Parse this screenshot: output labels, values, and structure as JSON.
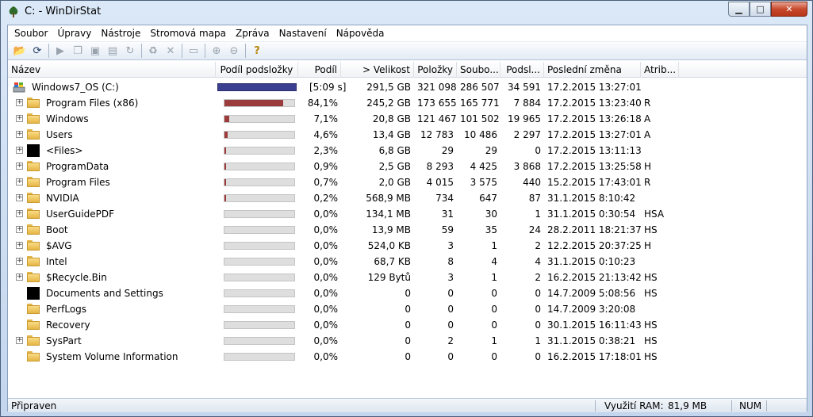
{
  "window": {
    "title": "C: - WinDirStat",
    "controls": {
      "minimize": "▁",
      "maximize": "□",
      "close": "✕"
    }
  },
  "menu": [
    "Soubor",
    "Úpravy",
    "Nástroje",
    "Stromová mapa",
    "Zpráva",
    "Nastavení",
    "Nápověda"
  ],
  "toolbar": {
    "icons": [
      "open-folder-icon",
      "refresh-icon",
      "play-icon",
      "copy-icon",
      "explorer-icon",
      "cmd-icon",
      "refresh-selected-icon",
      "recycle-icon",
      "delete-icon",
      "new-folder-icon",
      "zoom-in-icon",
      "zoom-out-icon",
      "help-icon"
    ]
  },
  "columns": [
    "Název",
    "Podíl podsložky",
    "Podíl",
    "> Velikost",
    "Položky",
    "Soubo...",
    "Podsl...",
    "Poslední změna",
    "Atrib..."
  ],
  "root": {
    "name": "Windows7_OS (C:)",
    "time": "[5:09 s]",
    "size": "291,5 GB",
    "items": "321 098",
    "files": "286 507",
    "subdirs": "34 591",
    "modified": "17.2.2015  13:27:01",
    "attrib": ""
  },
  "rows": [
    {
      "name": "Program Files (x86)",
      "expander": true,
      "icon": "folder",
      "fraction": 0.841,
      "pct": "84,1%",
      "size": "245,2 GB",
      "items": "173 655",
      "files": "165 771",
      "subdirs": "7 884",
      "modified": "17.2.2015  13:23:40",
      "attrib": "R"
    },
    {
      "name": "Windows",
      "expander": true,
      "icon": "folder",
      "fraction": 0.071,
      "pct": "7,1%",
      "size": "20,8 GB",
      "items": "121 467",
      "files": "101 502",
      "subdirs": "19 965",
      "modified": "17.2.2015  13:26:18",
      "attrib": "A"
    },
    {
      "name": "Users",
      "expander": true,
      "icon": "folder",
      "fraction": 0.046,
      "pct": "4,6%",
      "size": "13,4 GB",
      "items": "12 783",
      "files": "10 486",
      "subdirs": "2 297",
      "modified": "17.2.2015  13:27:01",
      "attrib": "A"
    },
    {
      "name": "<Files>",
      "expander": true,
      "icon": "black",
      "fraction": 0.023,
      "pct": "2,3%",
      "size": "6,8 GB",
      "items": "29",
      "files": "29",
      "subdirs": "0",
      "modified": "17.2.2015  13:11:13",
      "attrib": ""
    },
    {
      "name": "ProgramData",
      "expander": true,
      "icon": "folder",
      "fraction": 0.009,
      "pct": "0,9%",
      "size": "2,5 GB",
      "items": "8 293",
      "files": "4 425",
      "subdirs": "3 868",
      "modified": "17.2.2015  13:25:58",
      "attrib": "H"
    },
    {
      "name": "Program Files",
      "expander": true,
      "icon": "folder",
      "fraction": 0.007,
      "pct": "0,7%",
      "size": "2,0 GB",
      "items": "4 015",
      "files": "3 575",
      "subdirs": "440",
      "modified": "15.2.2015  17:43:01",
      "attrib": "R"
    },
    {
      "name": "NVIDIA",
      "expander": true,
      "icon": "folder",
      "fraction": 0.002,
      "pct": "0,2%",
      "size": "568,9 MB",
      "items": "734",
      "files": "647",
      "subdirs": "87",
      "modified": "31.1.2015  8:10:42",
      "attrib": ""
    },
    {
      "name": "UserGuidePDF",
      "expander": true,
      "icon": "folder",
      "fraction": 0.0,
      "pct": "0,0%",
      "size": "134,1 MB",
      "items": "31",
      "files": "30",
      "subdirs": "1",
      "modified": "31.1.2015  0:30:54",
      "attrib": "HSA"
    },
    {
      "name": "Boot",
      "expander": true,
      "icon": "folder",
      "fraction": 0.0,
      "pct": "0,0%",
      "size": "13,9 MB",
      "items": "59",
      "files": "35",
      "subdirs": "24",
      "modified": "28.2.2011  18:21:37",
      "attrib": "HS"
    },
    {
      "name": "$AVG",
      "expander": true,
      "icon": "folder",
      "fraction": 0.0,
      "pct": "0,0%",
      "size": "524,0 KB",
      "items": "3",
      "files": "1",
      "subdirs": "2",
      "modified": "12.2.2015  20:37:25",
      "attrib": "H"
    },
    {
      "name": "Intel",
      "expander": true,
      "icon": "folder",
      "fraction": 0.0,
      "pct": "0,0%",
      "size": "68,7 KB",
      "items": "8",
      "files": "4",
      "subdirs": "4",
      "modified": "31.1.2015  0:10:23",
      "attrib": ""
    },
    {
      "name": "$Recycle.Bin",
      "expander": true,
      "icon": "folder",
      "fraction": 0.0,
      "pct": "0,0%",
      "size": "129 Bytů",
      "items": "3",
      "files": "1",
      "subdirs": "2",
      "modified": "16.2.2015  21:13:42",
      "attrib": "HS"
    },
    {
      "name": "Documents and Settings",
      "expander": false,
      "icon": "black",
      "fraction": 0.0,
      "pct": "0,0%",
      "size": "0",
      "items": "0",
      "files": "0",
      "subdirs": "0",
      "modified": "14.7.2009  5:08:56",
      "attrib": "HS"
    },
    {
      "name": "PerfLogs",
      "expander": false,
      "icon": "folder",
      "fraction": 0.0,
      "pct": "0,0%",
      "size": "0",
      "items": "0",
      "files": "0",
      "subdirs": "0",
      "modified": "14.7.2009  3:20:08",
      "attrib": ""
    },
    {
      "name": "Recovery",
      "expander": false,
      "icon": "folder",
      "fraction": 0.0,
      "pct": "0,0%",
      "size": "0",
      "items": "0",
      "files": "0",
      "subdirs": "0",
      "modified": "30.1.2015  16:11:43",
      "attrib": "HS"
    },
    {
      "name": "SysPart",
      "expander": true,
      "icon": "folder",
      "fraction": 0.0,
      "pct": "0,0%",
      "size": "0",
      "items": "2",
      "files": "1",
      "subdirs": "1",
      "modified": "31.1.2015  0:38:21",
      "attrib": "HS"
    },
    {
      "name": "System Volume Information",
      "expander": false,
      "icon": "folder",
      "fraction": 0.0,
      "pct": "0,0%",
      "size": "0",
      "items": "0",
      "files": "0",
      "subdirs": "0",
      "modified": "16.2.2015  17:18:01",
      "attrib": "HS"
    }
  ],
  "status": {
    "ready": "Připraven",
    "ram_label": "Využití RAM:",
    "ram_value": "81,9 MB",
    "num": "NUM"
  },
  "colors": {
    "bar_fill": "#9b3b3b",
    "bar_root": "#3a3f8f"
  }
}
